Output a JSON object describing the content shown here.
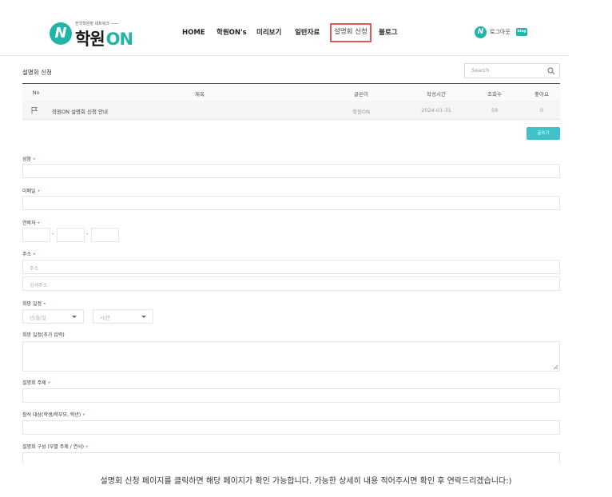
{
  "header": {
    "logo_sub": "전국학원장 네트워크 ——",
    "logo_main": "학원",
    "logo_on": "ON",
    "nav": [
      "HOME",
      "학원ON's",
      "미리보기",
      "일반자료",
      "설명회 신청",
      "블로그"
    ],
    "logout": "로그아웃",
    "blog_badge": "blog"
  },
  "board": {
    "title": "설명회 신청",
    "search_placeholder": "Search",
    "columns": [
      "No",
      "제목",
      "글쓴이",
      "작성시간",
      "조회수",
      "좋아요"
    ],
    "row": {
      "title": "학원ON 설명회 신청 안내",
      "author": "학원ON",
      "date": "2024-01-31",
      "views": "59",
      "likes": "0"
    },
    "write_button": "글쓰기"
  },
  "form": {
    "name_label": "성함",
    "email_label": "이메일",
    "phone_label": "연락처",
    "address_label": "주소",
    "address_placeholder": "주소",
    "address_detail_placeholder": "상세주소",
    "date_label": "희망 일정",
    "date_placeholder": "년/월/일",
    "time_placeholder": "시/분",
    "date_extra_label": "희망 일정(추가 입력)",
    "topic_label": "설명회 주제",
    "audience_label": "참석 대상(학생/학부모, 학년)",
    "structure_label": "설명회 구성 (부별 주제 / 연사)",
    "required_mark": "•"
  },
  "caption": "설명회 신청 페이지를 클릭하면 해당 페이지가 확인 가능합니다. 가능한 상세히 내용 적어주시면 확인 후 연락드리겠습니다:)"
}
